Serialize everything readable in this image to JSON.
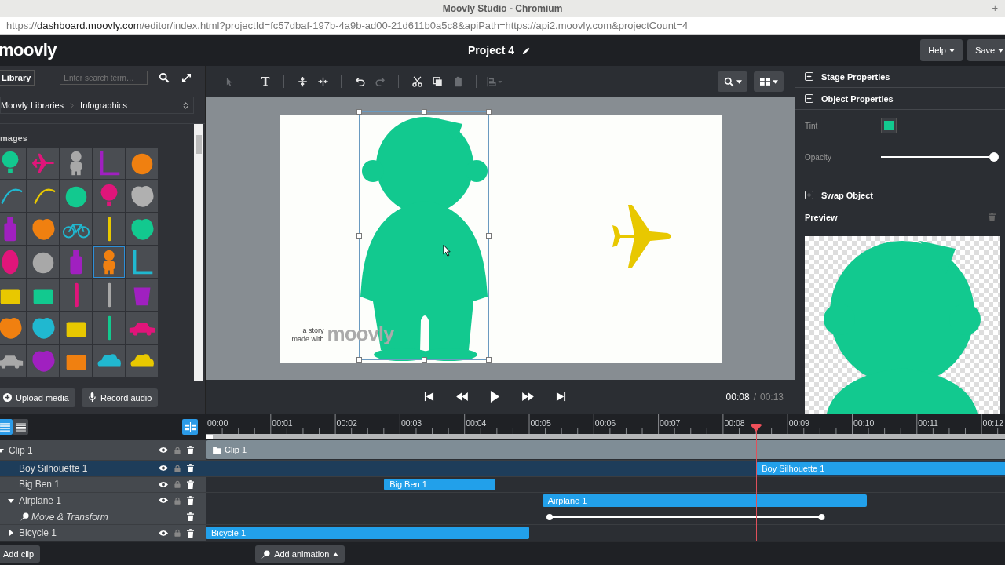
{
  "browser": {
    "title": "Moovly Studio - Chromium",
    "controls": [
      "–",
      "+"
    ],
    "url_scheme": "https://",
    "url_host": "dashboard.moovly.com",
    "url_path": "/editor/index.html?projectId=fc57dbaf-197b-4a9b-ad00-21d611b0a5c8&apiPath=https://api2.moovly.com&projectCount=4"
  },
  "header": {
    "logo": "moovly",
    "project_title": "Project 4",
    "buttons": [
      "Help",
      "Save"
    ]
  },
  "library": {
    "tab": "Library",
    "search_placeholder": "Enter search term…",
    "breadcrumb": [
      "Moovly Libraries",
      "Infographics"
    ],
    "section": "mages",
    "tiles": [
      {
        "kind": "balloon",
        "color": "#12c98f",
        "selected": false
      },
      {
        "kind": "plane",
        "color": "#e0157a",
        "selected": false
      },
      {
        "kind": "figure",
        "color": "#a8a8a8",
        "selected": false
      },
      {
        "kind": "bracket",
        "color": "#a020c0",
        "selected": false
      },
      {
        "kind": "circle",
        "color": "#f08010",
        "selected": false
      },
      {
        "kind": "curve",
        "color": "#20b8d0",
        "selected": false
      },
      {
        "kind": "curve",
        "color": "#e8c800",
        "selected": false
      },
      {
        "kind": "circle",
        "color": "#12c98f",
        "selected": false
      },
      {
        "kind": "balloon",
        "color": "#e0157a",
        "selected": false
      },
      {
        "kind": "blob",
        "color": "#b0b0b0",
        "selected": false
      },
      {
        "kind": "bottle",
        "color": "#a020c0",
        "selected": false
      },
      {
        "kind": "blob",
        "color": "#f08010",
        "selected": false
      },
      {
        "kind": "bicycle",
        "color": "#20b8d0",
        "selected": false
      },
      {
        "kind": "pin",
        "color": "#e8c800",
        "selected": false
      },
      {
        "kind": "blob",
        "color": "#12c98f",
        "selected": false
      },
      {
        "kind": "oval",
        "color": "#e0157a",
        "selected": false
      },
      {
        "kind": "circle",
        "color": "#a8a8a8",
        "selected": false
      },
      {
        "kind": "bottle",
        "color": "#a020c0",
        "selected": false
      },
      {
        "kind": "figure",
        "color": "#f08010",
        "selected": true
      },
      {
        "kind": "bracket",
        "color": "#20b8d0",
        "selected": false
      },
      {
        "kind": "rect",
        "color": "#e8c800",
        "selected": false
      },
      {
        "kind": "rect",
        "color": "#12c98f",
        "selected": false
      },
      {
        "kind": "pin",
        "color": "#e0157a",
        "selected": false
      },
      {
        "kind": "pin",
        "color": "#a8a8a8",
        "selected": false
      },
      {
        "kind": "cup",
        "color": "#a020c0",
        "selected": false
      },
      {
        "kind": "blob",
        "color": "#f08010",
        "selected": false
      },
      {
        "kind": "blob",
        "color": "#20b8d0",
        "selected": false
      },
      {
        "kind": "rect",
        "color": "#e8c800",
        "selected": false
      },
      {
        "kind": "pin",
        "color": "#12c98f",
        "selected": false
      },
      {
        "kind": "car",
        "color": "#e0157a",
        "selected": false
      },
      {
        "kind": "car",
        "color": "#a8a8a8",
        "selected": false
      },
      {
        "kind": "blob",
        "color": "#a020c0",
        "selected": false
      },
      {
        "kind": "rect",
        "color": "#f08010",
        "selected": false
      },
      {
        "kind": "cloud",
        "color": "#20b8d0",
        "selected": false
      },
      {
        "kind": "cloud",
        "color": "#e8c800",
        "selected": false
      }
    ],
    "buttons": [
      {
        "label": "Upload media",
        "kind": "upload"
      },
      {
        "label": "Record audio",
        "kind": "record"
      }
    ]
  },
  "toolbar": {
    "tools": [
      {
        "kind": "select",
        "disabled": true
      },
      {
        "kind": "text",
        "glyph": "T",
        "disabled": false
      },
      {
        "kind": "align-v",
        "disabled": false
      },
      {
        "kind": "align-h",
        "disabled": false
      },
      {
        "kind": "undo",
        "disabled": false
      },
      {
        "kind": "redo",
        "disabled": true
      },
      {
        "kind": "cut",
        "disabled": false
      },
      {
        "kind": "copy",
        "disabled": false
      },
      {
        "kind": "paste",
        "disabled": true
      },
      {
        "kind": "arrange",
        "disabled": true
      }
    ],
    "menus": [
      {
        "kind": "zoom"
      },
      {
        "kind": "layout"
      }
    ]
  },
  "stage": {
    "credit": [
      "a story",
      "made with"
    ],
    "logo": "moovly",
    "boy_selected": true
  },
  "player": {
    "controls": [
      {
        "kind": "first"
      },
      {
        "kind": "rewind"
      },
      {
        "kind": "play"
      },
      {
        "kind": "forward"
      },
      {
        "kind": "last"
      }
    ],
    "current_time": "00:08",
    "separator": "/",
    "duration": "00:13"
  },
  "properties": {
    "sections": [
      {
        "title": "Stage Properties",
        "expanded": false
      },
      {
        "title": "Object Properties",
        "expanded": true,
        "fields": [
          {
            "label": "Tint",
            "kind": "color",
            "color": "#12c98f"
          },
          {
            "label": "Opacity",
            "kind": "slider",
            "level": 1
          }
        ]
      },
      {
        "title": "Swap Object",
        "expanded": false
      }
    ],
    "preview": {
      "title": "Preview"
    }
  },
  "timeline": {
    "view_modes": [
      {
        "kind": "tree",
        "selected": true
      },
      {
        "kind": "list",
        "selected": false
      }
    ],
    "snap": {
      "on": true
    },
    "ruler": [
      "00:00",
      "00:01",
      "00:02",
      "00:03",
      "00:04",
      "00:05",
      "00:06",
      "00:07",
      "00:08",
      "00:09",
      "00:10",
      "00:11",
      "00:12"
    ],
    "layers": [
      {
        "name": "Clip 1",
        "kind": "clip",
        "expanded": true,
        "selected": false,
        "visible": true,
        "locked": false,
        "bar": {
          "label": "Clip 1"
        },
        "children": [
          {
            "name": "Boy Silhouette 1",
            "kind": "object",
            "selected": true,
            "visible": true,
            "locked": false,
            "bar": {
              "label": "Boy Silhouette 1"
            }
          },
          {
            "name": "Big Ben 1",
            "kind": "object",
            "selected": false,
            "visible": true,
            "locked": false,
            "bar": {
              "label": "Big Ben 1"
            }
          },
          {
            "name": "Airplane 1",
            "kind": "object",
            "expanded": true,
            "selected": false,
            "visible": true,
            "locked": false,
            "bar": {
              "label": "Airplane 1"
            },
            "children": [
              {
                "name": "Move & Transform",
                "kind": "animation",
                "selected": false
              }
            ]
          },
          {
            "name": "Bicycle 1",
            "kind": "object",
            "expanded": false,
            "selected": false,
            "visible": true,
            "locked": false,
            "bar": {
              "label": "Bicycle 1"
            }
          }
        ]
      }
    ]
  },
  "footer": {
    "add_clip": "Add clip",
    "add_animation": "Add animation"
  }
}
